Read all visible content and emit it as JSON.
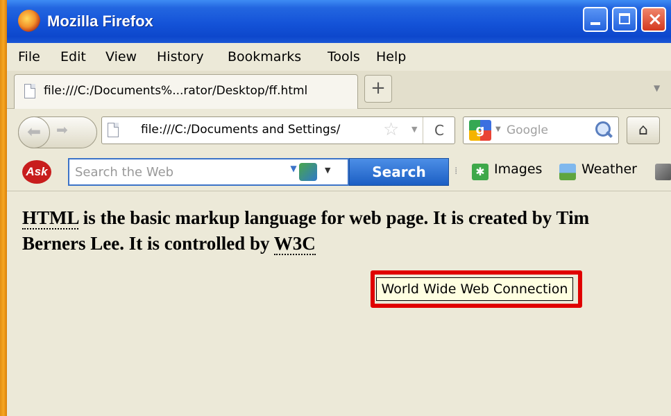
{
  "window": {
    "title": "Mozilla Firefox"
  },
  "menu": [
    "File",
    "Edit",
    "View",
    "History",
    "Bookmarks",
    "Tools",
    "Help"
  ],
  "tabs": [
    {
      "title": "file:///C:/Documents%...rator/Desktop/ff.html"
    }
  ],
  "new_tab_label": "+",
  "address_bar": {
    "value": "file:///C:/Documents and Settings/",
    "reload": "C"
  },
  "search_bar": {
    "placeholder": "Google"
  },
  "ask_toolbar": {
    "logo": "Ask",
    "placeholder": "Search the Web",
    "search_button": "Search",
    "links": [
      "Images",
      "Weather"
    ]
  },
  "page": {
    "abbr_html": "HTML",
    "text1": " is the basic markup language for web page. It is created by Tim Berners Lee. It is controlled by ",
    "abbr_w3c": "W3C",
    "tooltip": "World Wide Web Connection"
  },
  "colors": {
    "highlight": "#e00000",
    "tooltip_bg": "#ffffe1",
    "titlebar": "#0d47cc"
  },
  "icons": [
    "firefox-icon",
    "page-icon",
    "star-icon",
    "reload-icon",
    "google-icon",
    "magnifier-icon",
    "home-icon",
    "ask-logo",
    "globe-icon",
    "images-icon",
    "weather-icon"
  ]
}
